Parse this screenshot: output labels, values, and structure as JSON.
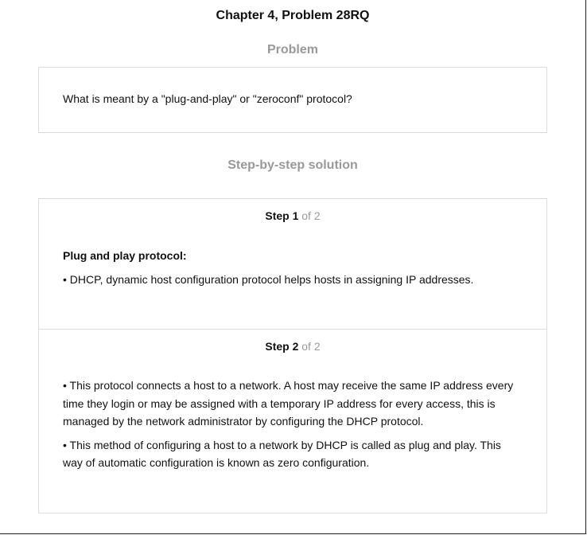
{
  "header": {
    "chapter_title": "Chapter 4, Problem 28RQ"
  },
  "problem": {
    "heading": "Problem",
    "text": "What is meant by a \"plug-and-play\" or \"zeroconf\" protocol?"
  },
  "solution": {
    "heading": "Step-by-step solution",
    "steps": [
      {
        "label": "Step 1",
        "of": " of 2",
        "subheading": "Plug and play protocol:",
        "paragraphs": [
          "• DHCP, dynamic host configuration protocol helps hosts in assigning IP addresses."
        ]
      },
      {
        "label": "Step 2",
        "of": " of 2",
        "paragraphs": [
          "• This protocol connects a host to a network. A host may receive the same IP address every time they login or may be assigned with a temporary IP address for every access, this is managed by the network administrator by configuring the DHCP protocol.",
          "• This method of configuring a host to a network by DHCP is called as plug and play. This way of automatic configuration is known as zero configuration."
        ]
      }
    ]
  }
}
